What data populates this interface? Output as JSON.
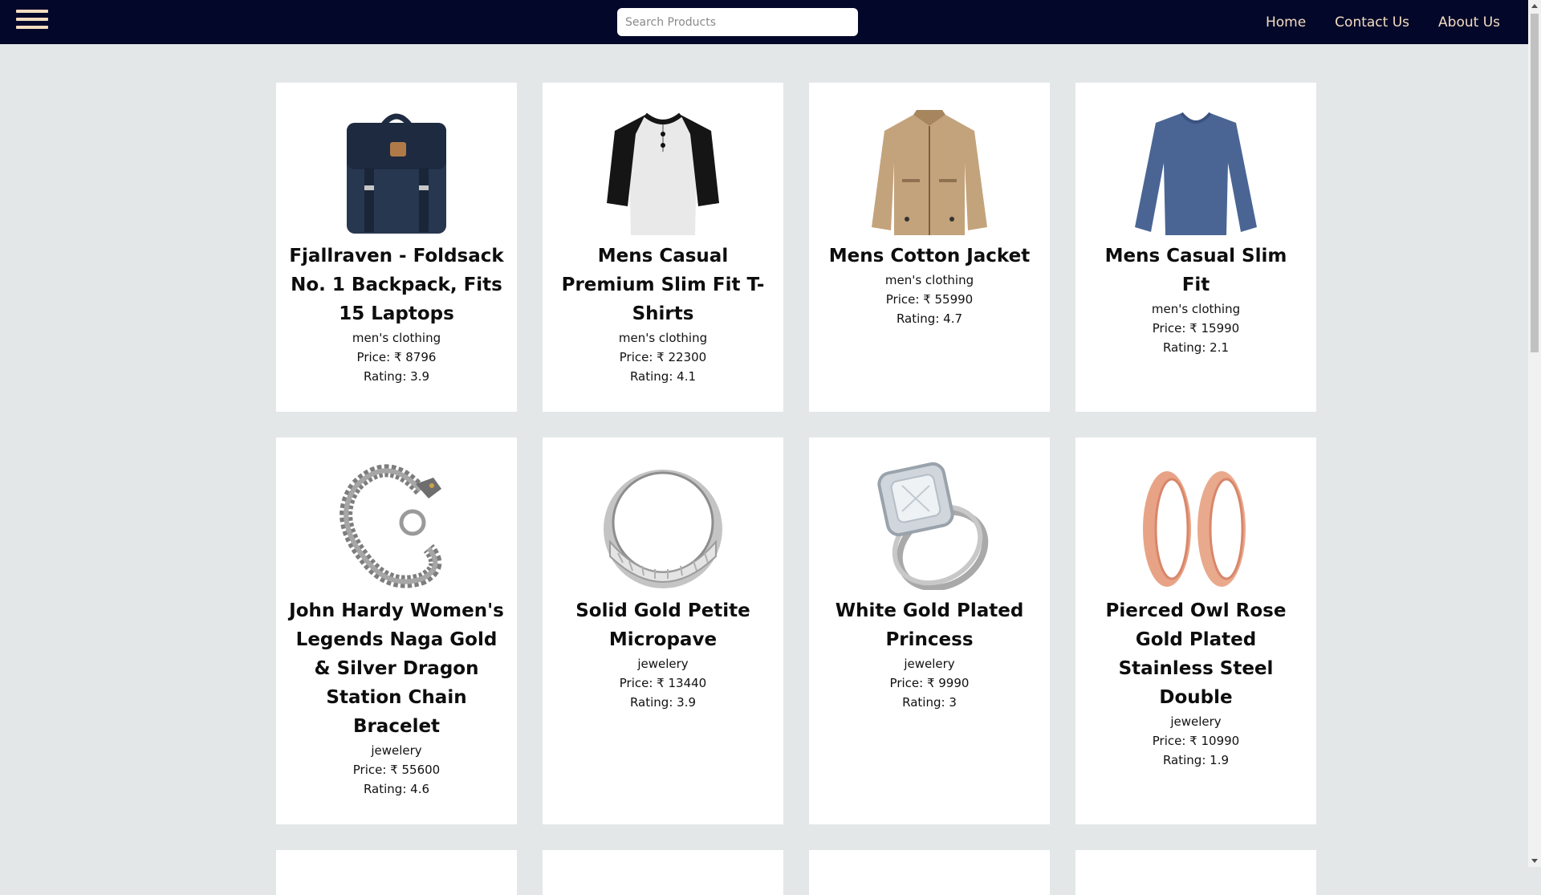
{
  "nav": {
    "search_placeholder": "Search Products",
    "links": [
      "Home",
      "Contact Us",
      "About Us"
    ]
  },
  "colors": {
    "navbar": "#03082a",
    "accent": "#f3dcc0",
    "page_bg": "#e3e7e8"
  },
  "labels": {
    "price_prefix": "Price: ₹ ",
    "rating_prefix": "Rating: "
  },
  "products": [
    {
      "title": "Fjallraven - Foldsack No. 1 Backpack, Fits 15 Laptops",
      "category": "men's clothing",
      "price": "8796",
      "rating": "3.9",
      "image": "backpack"
    },
    {
      "title": "Mens Casual Premium Slim Fit T-Shirts",
      "category": "men's clothing",
      "price": "22300",
      "rating": "4.1",
      "image": "tshirt"
    },
    {
      "title": "Mens Cotton Jacket",
      "category": "men's clothing",
      "price": "55990",
      "rating": "4.7",
      "image": "jacket"
    },
    {
      "title": "Mens Casual Slim Fit",
      "category": "men's clothing",
      "price": "15990",
      "rating": "2.1",
      "image": "longsleeve"
    },
    {
      "title": "John Hardy Women's Legends Naga Gold & Silver Dragon Station Chain Bracelet",
      "category": "jewelery",
      "price": "55600",
      "rating": "4.6",
      "image": "bracelet"
    },
    {
      "title": "Solid Gold Petite Micropave",
      "category": "jewelery",
      "price": "13440",
      "rating": "3.9",
      "image": "silver-ring"
    },
    {
      "title": "White Gold Plated Princess",
      "category": "jewelery",
      "price": "9990",
      "rating": "3",
      "image": "diamond-ring"
    },
    {
      "title": "Pierced Owl Rose Gold Plated Stainless Steel Double",
      "category": "jewelery",
      "price": "10990",
      "rating": "1.9",
      "image": "rose-gold-tunnels"
    }
  ]
}
